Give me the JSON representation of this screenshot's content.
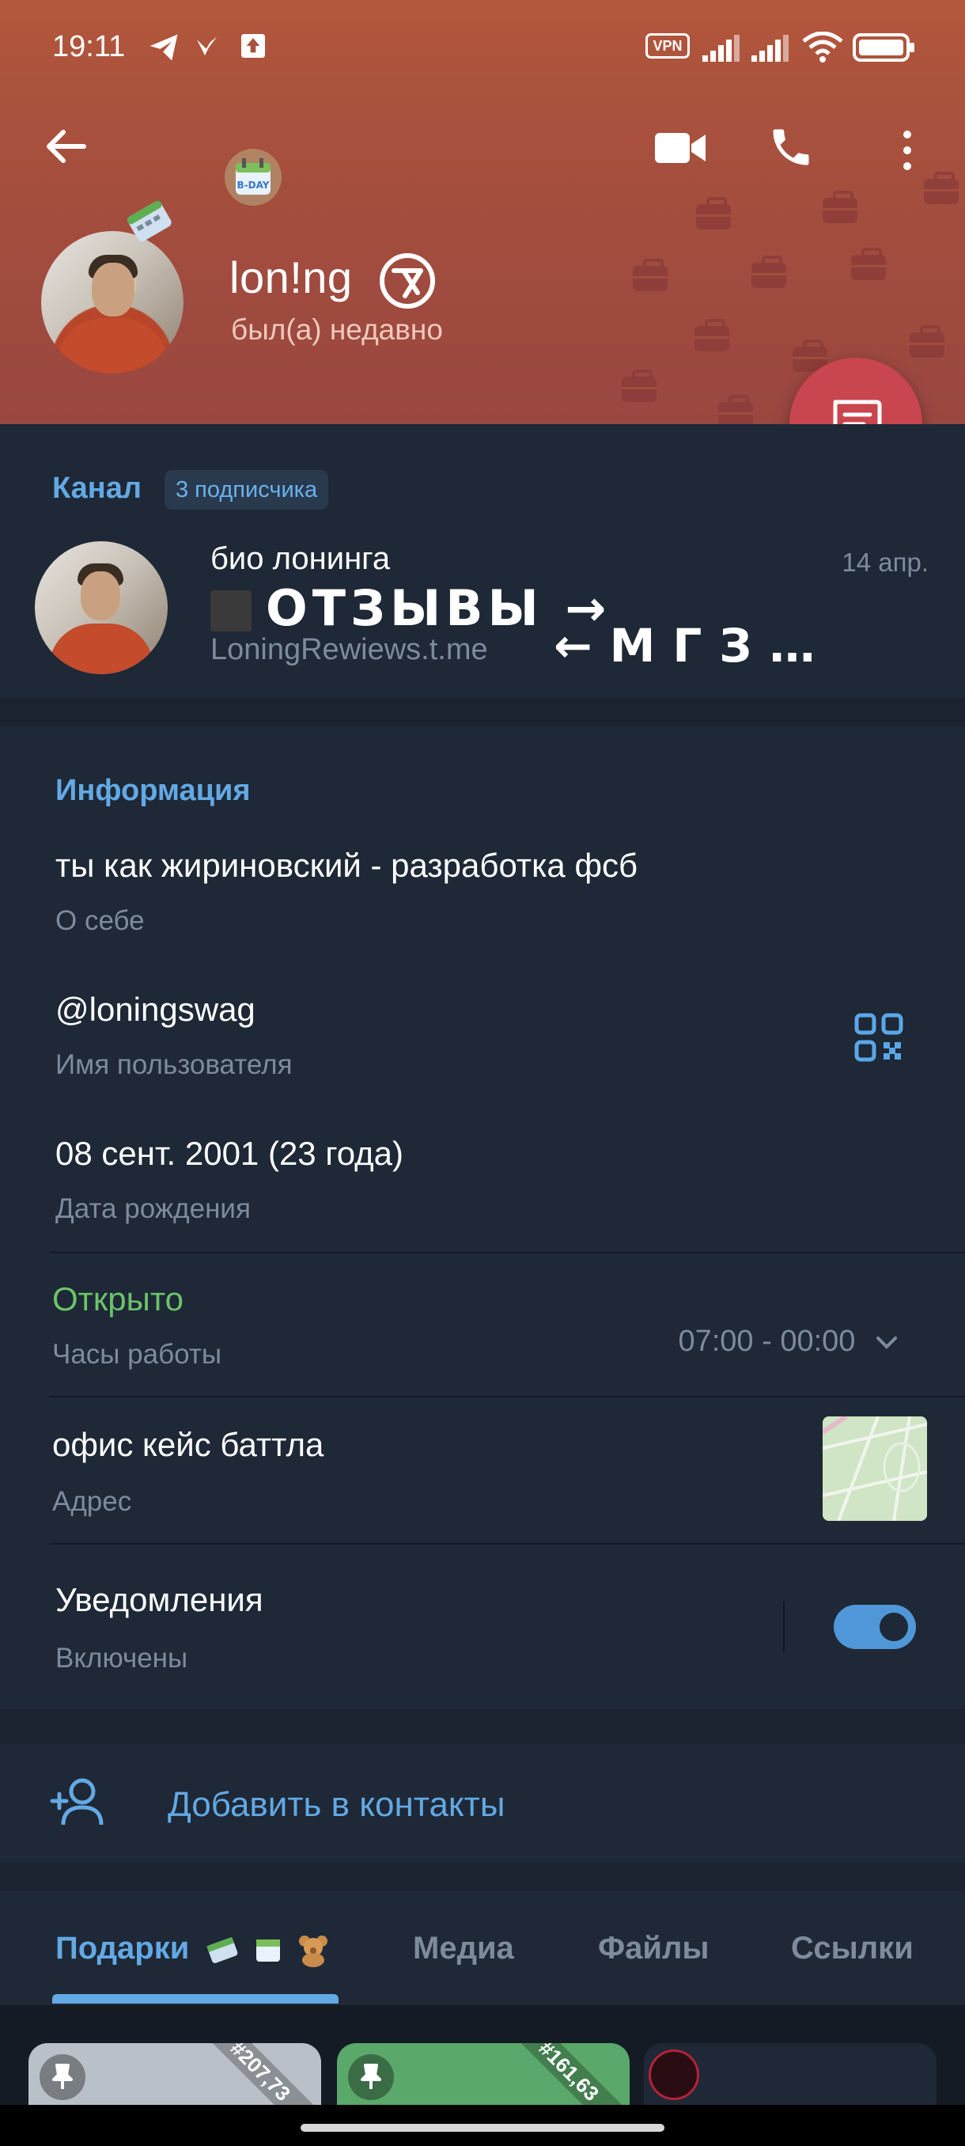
{
  "status_bar": {
    "time": "19:11",
    "vpn_label": "VPN",
    "icons": [
      "telegram-icon",
      "vk-icon",
      "upload-icon",
      "signal-icon",
      "signal-icon",
      "wifi-icon",
      "battery-icon"
    ]
  },
  "header": {
    "back_icon": "arrow-left-icon",
    "actions": [
      "video-call-icon",
      "phone-icon",
      "more-vert-icon"
    ],
    "name": "lon!ng",
    "status": "был(а) недавно",
    "accent_color": "#a44e3e"
  },
  "channel": {
    "section_label": "Канал",
    "subscribers": "3 подписчика",
    "name": "био лонинга",
    "date": "14 апр.",
    "post_text": "ОТЗЫВЫ →",
    "link": "LoningRewiews.t.me",
    "link_suffix": "←МГЗ…"
  },
  "info": {
    "title": "Информация",
    "about_value": "ты как жириновский - разработка фсб",
    "about_label": "О себе",
    "username_value": "@loningswag",
    "username_label": "Имя пользователя",
    "birthday_value": "08 сент. 2001 (23 года)",
    "birthday_label": "Дата рождения",
    "hours_status": "Открыто",
    "hours_label": "Часы работы",
    "hours_value": "07:00 - 00:00",
    "address_value": "офис кейс баттла",
    "address_label": "Адрес",
    "notifications_value": "Уведомления",
    "notifications_label": "Включены",
    "notifications_on": true,
    "open_color": "#6cc36a"
  },
  "add_contact": {
    "label": "Добавить в контакты"
  },
  "tabs": [
    {
      "label": "Подарки",
      "active": true
    },
    {
      "label": "Медиа",
      "active": false
    },
    {
      "label": "Файлы",
      "active": false
    },
    {
      "label": "Ссылки",
      "active": false
    }
  ],
  "gifts": [
    {
      "number": "#207,73",
      "color": "#b9c0c8"
    },
    {
      "number": "#161,63",
      "color": "#5aa86a"
    },
    {
      "number": "",
      "color": "#1e2836"
    }
  ]
}
